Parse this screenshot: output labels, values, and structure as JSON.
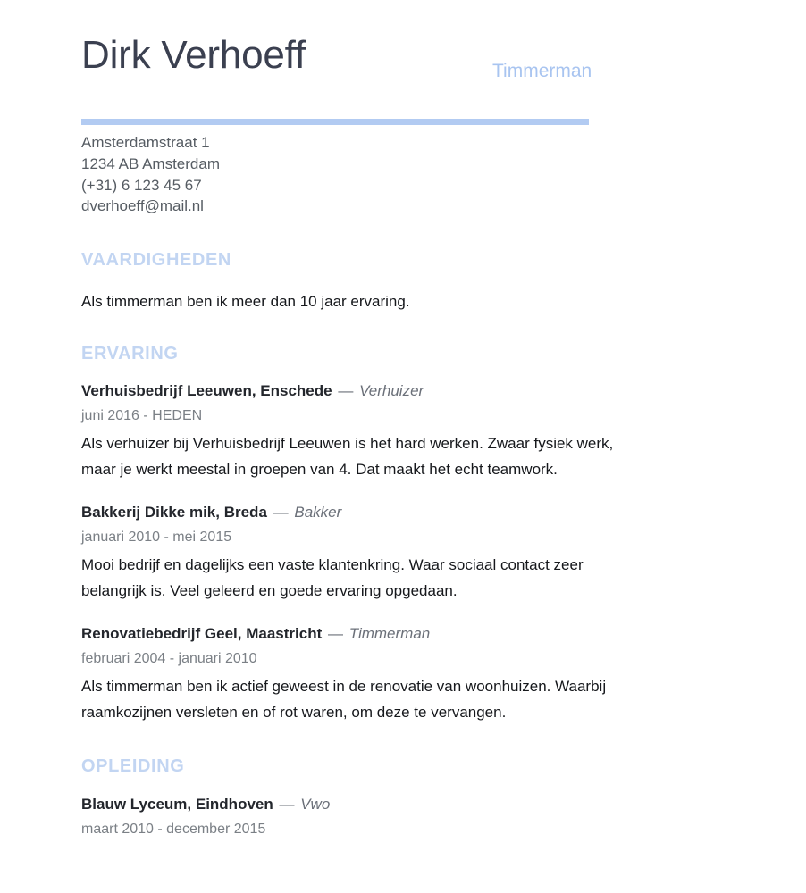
{
  "header": {
    "name": "Dirk Verhoeff",
    "job_subtitle": "Timmerman"
  },
  "contact": {
    "street": "Amsterdamstraat 1",
    "city": "1234 AB Amsterdam",
    "phone": "(+31) 6 123 45 67",
    "email": "dverhoeff@mail.nl"
  },
  "skills": {
    "heading": "VAARDIGHEDEN",
    "text": "Als timmerman ben ik meer dan 10 jaar ervaring."
  },
  "experience": {
    "heading": "ERVARING",
    "entries": [
      {
        "employer": "Verhuisbedrijf Leeuwen, Enschede",
        "separator": "—",
        "role": "Verhuizer",
        "dates": "juni 2016 - HEDEN",
        "description": "Als verhuizer bij Verhuisbedrijf Leeuwen is het hard werken. Zwaar fysiek werk, maar je werkt meestal in groepen van 4. Dat maakt het echt teamwork."
      },
      {
        "employer": "Bakkerij Dikke mik, Breda",
        "separator": "—",
        "role": "Bakker",
        "dates": "januari 2010 - mei 2015",
        "description": "Mooi bedrijf en dagelijks een vaste klantenkring. Waar sociaal contact zeer belangrijk is. Veel geleerd en goede ervaring opgedaan."
      },
      {
        "employer": "Renovatiebedrijf Geel, Maastricht",
        "separator": "—",
        "role": "Timmerman",
        "dates": "februari 2004 - januari 2010",
        "description": "Als timmerman ben ik actief geweest in de renovatie van woonhuizen. Waarbij raamkozijnen versleten en of rot waren, om deze te vervangen."
      }
    ]
  },
  "education": {
    "heading": "OPLEIDING",
    "entries": [
      {
        "school": "Blauw Lyceum, Eindhoven",
        "separator": "—",
        "degree": "Vwo",
        "dates": "maart 2010 - december 2015"
      }
    ]
  },
  "colors": {
    "accent_bar": "#b2cbf2",
    "section_heading": "#c2d5f2",
    "subtitle": "#a8c4f0",
    "name": "#3b4050",
    "body": "#16181c",
    "muted": "#7b8086"
  }
}
